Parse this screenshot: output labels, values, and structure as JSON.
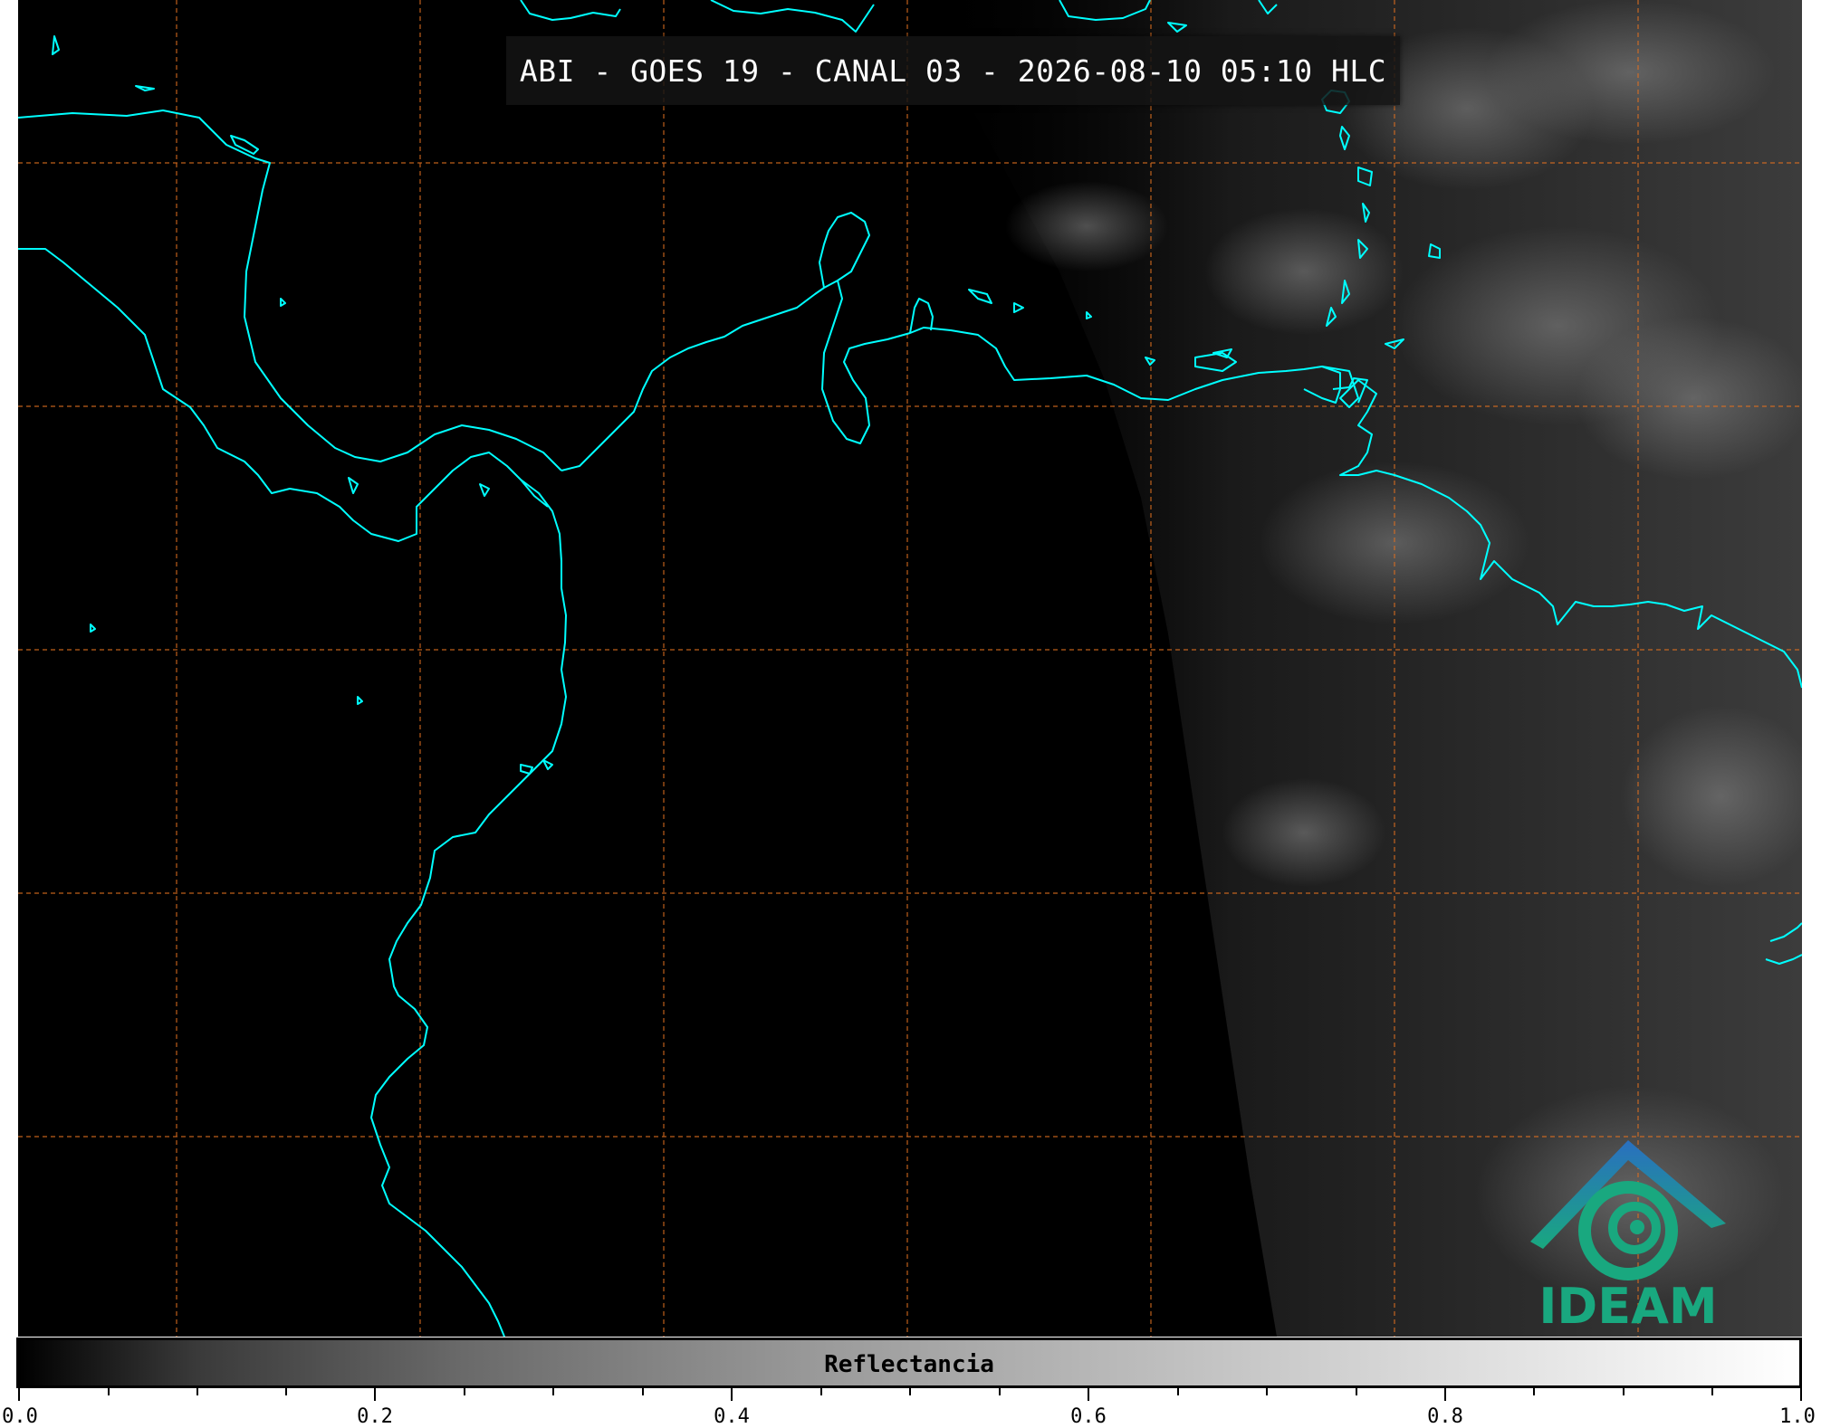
{
  "title": "ABI - GOES 19 - CANAL 03 - 2026-08-10 05:10 HLC",
  "colorbar": {
    "label": "Reflectancia",
    "ticks": [
      "0.0",
      "0.2",
      "0.4",
      "0.6",
      "0.8",
      "1.0"
    ]
  },
  "logo": {
    "text": "IDEAM"
  },
  "colors": {
    "coastline": "#00ffff",
    "grid": "#e07020",
    "logo_blue": "#2a6fc0",
    "logo_green": "#19a87f"
  }
}
